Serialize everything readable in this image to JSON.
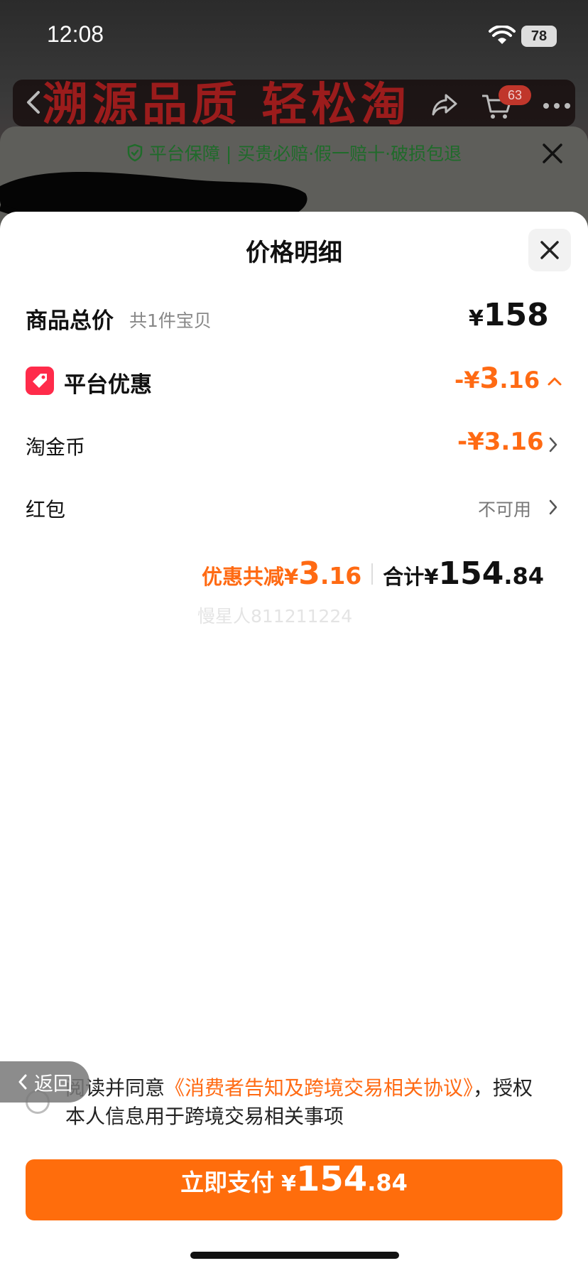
{
  "status_bar": {
    "time": "12:08",
    "battery": "78"
  },
  "background_page": {
    "banner_text": "溯源品质 轻松淘",
    "cart_badge": "63"
  },
  "guarantee_sheet": {
    "text": "平台保障 | 买贵必赔·假一赔十·破损包退"
  },
  "price_detail": {
    "title": "价格明细",
    "total": {
      "label": "商品总价",
      "sub": "共1件宝贝",
      "yen": "¥",
      "value": "158"
    },
    "platform_discount": {
      "label": "平台优惠",
      "prefix": "-¥",
      "int": "3",
      "dec": ".16"
    },
    "taojinbi": {
      "label": "淘金币",
      "value": "-¥3.16"
    },
    "hongbao": {
      "label": "红包",
      "value": "不可用"
    },
    "summary": {
      "discount_label": "优惠共减¥",
      "discount_int": "3",
      "discount_dec": ".16",
      "total_label": "合计¥",
      "total_int": "154",
      "total_dec": ".84"
    },
    "watermark": "慢星人811211224"
  },
  "agreement": {
    "prefix": "阅读并同意",
    "link": "《消费者告知及跨境交易相关协议》",
    "suffix": "，授权本人信息用于跨境交易相关事项"
  },
  "back_pill": {
    "label": "返回"
  },
  "pay_button": {
    "label": "立即支付",
    "yen": "¥",
    "int": "154",
    "dec": ".84"
  },
  "colors": {
    "accent": "#ff6a13",
    "pay": "#ff6d0c",
    "coupon": "#ff2b4a",
    "guarantee": "#1f6b2a"
  }
}
